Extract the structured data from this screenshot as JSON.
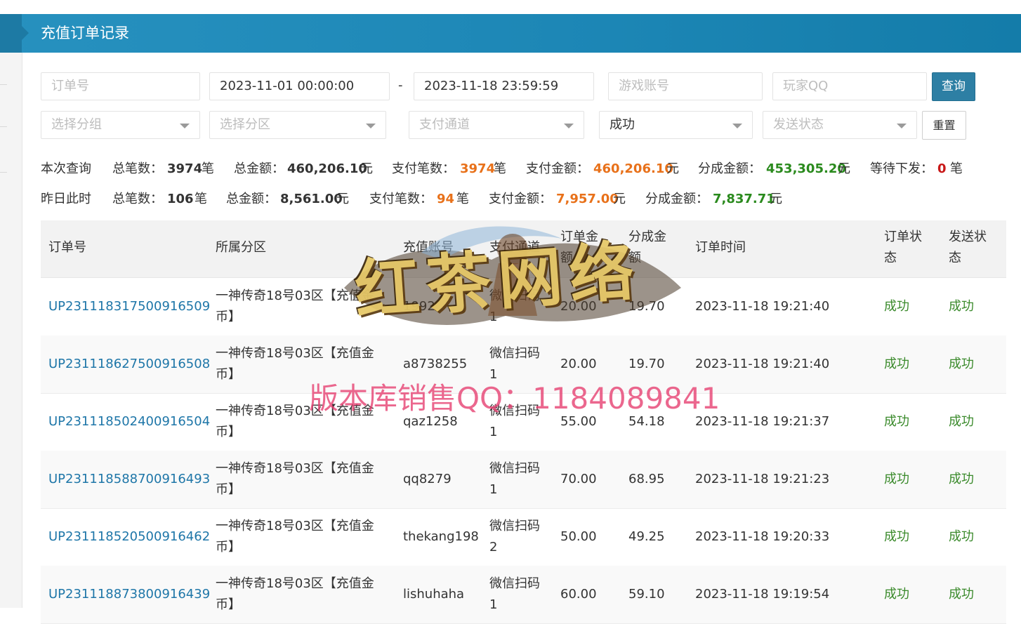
{
  "header": {
    "title": "充值订单记录"
  },
  "filters": {
    "order_no_placeholder": "订单号",
    "date_start": "2023-11-01 00:00:00",
    "date_separator": "-",
    "date_end": "2023-11-18 23:59:59",
    "game_account_placeholder": "游戏账号",
    "player_qq_placeholder": "玩家QQ",
    "query_label": "查询",
    "group_placeholder": "选择分组",
    "zone_placeholder": "选择分区",
    "pay_channel_placeholder": "支付通道",
    "status_selected": "成功",
    "send_status_placeholder": "发送状态",
    "reset_label": "重置"
  },
  "stats_current": {
    "label": "本次查询",
    "total_count_label": "总笔数：",
    "total_count": "3974",
    "count_unit": "笔",
    "total_amount_label": "总金额：",
    "total_amount": "460,206.10",
    "amount_unit": "元",
    "paid_count_label": "支付笔数：",
    "paid_count": "3974",
    "paid_count_unit": "笔",
    "paid_amount_label": "支付金额：",
    "paid_amount": "460,206.10",
    "paid_amount_unit": "元",
    "share_amount_label": "分成金额：",
    "share_amount": "453,305.20",
    "share_amount_unit": "元",
    "pending_label": "等待下发：",
    "pending": "0",
    "pending_unit": "笔"
  },
  "stats_yesterday": {
    "label": "昨日此时",
    "total_count_label": "总笔数：",
    "total_count": "106",
    "count_unit": "笔",
    "total_amount_label": "总金额：",
    "total_amount": "8,561.00",
    "amount_unit": "元",
    "paid_count_label": "支付笔数：",
    "paid_count": "94",
    "paid_count_unit": "笔",
    "paid_amount_label": "支付金额：",
    "paid_amount": "7,957.00",
    "paid_amount_unit": "元",
    "share_amount_label": "分成金额：",
    "share_amount": "7,837.71",
    "share_amount_unit": "元"
  },
  "table": {
    "headers": {
      "order_no": "订单号",
      "zone": "所属分区",
      "account": "充值账号",
      "channel": "支付通道",
      "amount": "订单金额",
      "share": "分成金额",
      "time": "订单时间",
      "order_status": "订单状态",
      "send_status": "发送状态"
    },
    "rows": [
      {
        "order_no": "UP231118317500916509",
        "zone": "一神传奇18号03区【充值金币】",
        "account": "1992",
        "channel": "微信扫码1",
        "amount": "20.00",
        "share": "19.70",
        "time": "2023-11-18 19:21:40",
        "order_status": "成功",
        "send_status": "成功"
      },
      {
        "order_no": "UP231118627500916508",
        "zone": "一神传奇18号03区【充值金币】",
        "account": "a8738255",
        "channel": "微信扫码1",
        "amount": "20.00",
        "share": "19.70",
        "time": "2023-11-18 19:21:40",
        "order_status": "成功",
        "send_status": "成功"
      },
      {
        "order_no": "UP231118502400916504",
        "zone": "一神传奇18号03区【充值金币】",
        "account": "qaz1258",
        "channel": "微信扫码1",
        "amount": "55.00",
        "share": "54.18",
        "time": "2023-11-18 19:21:37",
        "order_status": "成功",
        "send_status": "成功"
      },
      {
        "order_no": "UP231118588700916493",
        "zone": "一神传奇18号03区【充值金币】",
        "account": "qq8279",
        "channel": "微信扫码1",
        "amount": "70.00",
        "share": "68.95",
        "time": "2023-11-18 19:21:23",
        "order_status": "成功",
        "send_status": "成功"
      },
      {
        "order_no": "UP231118520500916462",
        "zone": "一神传奇18号03区【充值金币】",
        "account": "thekang198",
        "channel": "微信扫码2",
        "amount": "50.00",
        "share": "49.25",
        "time": "2023-11-18 19:20:33",
        "order_status": "成功",
        "send_status": "成功"
      },
      {
        "order_no": "UP231118873800916439",
        "zone": "一神传奇18号03区【充值金币】",
        "account": "lishuhaha",
        "channel": "微信扫码1",
        "amount": "60.00",
        "share": "59.10",
        "time": "2023-11-18 19:19:54",
        "order_status": "成功",
        "send_status": "成功"
      }
    ]
  },
  "watermark": {
    "logo_text": "红茶网络",
    "seller_text": "版本库销售QQ：1184089841"
  },
  "colors": {
    "header_bar": "#1c86b5",
    "query_button": "#2d7fa4",
    "link": "#1e76a8",
    "success": "#3a8a2b",
    "orange_value": "#e8711a",
    "green_value": "#2a8a1d",
    "red_value": "#c81818"
  }
}
